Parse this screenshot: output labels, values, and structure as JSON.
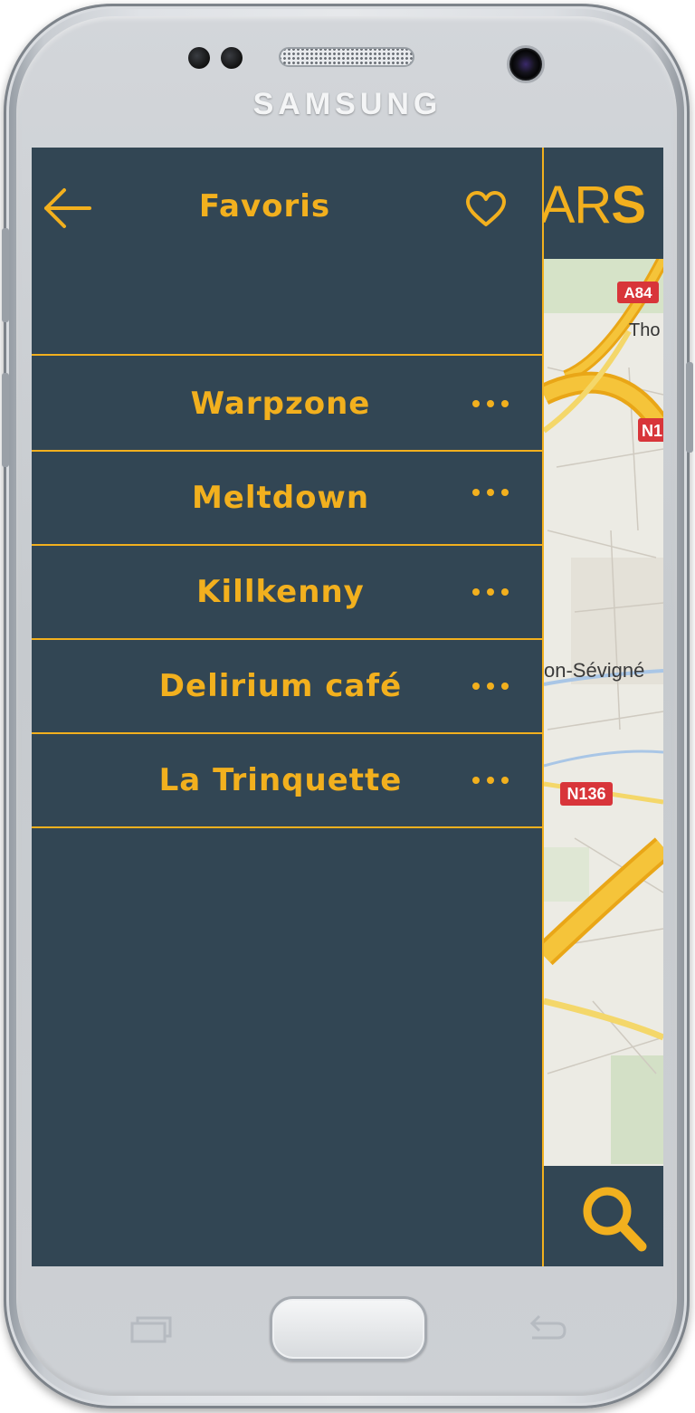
{
  "device": {
    "brand": "SAMSUNG"
  },
  "app": {
    "logo_prefix": "AR",
    "logo_suffix": "S",
    "map_labels": {
      "road_a84": "A84",
      "town_north": "Tho",
      "road_n1": "N1",
      "town_center": "on-Sévigné",
      "road_n136": "N136"
    }
  },
  "drawer": {
    "title": "Favoris",
    "favorites": [
      {
        "name": "Warpzone"
      },
      {
        "name": "Meltdown"
      },
      {
        "name": "Killkenny"
      },
      {
        "name": "Delirium café"
      },
      {
        "name": "La Trinquette"
      }
    ]
  },
  "colors": {
    "accent": "#f2b01e",
    "background": "#324654",
    "map": "#ecebe4"
  },
  "icons": {
    "back": "back-arrow-icon",
    "favorites": "heart-icon",
    "more": "more-dots-icon",
    "search": "search-icon"
  }
}
